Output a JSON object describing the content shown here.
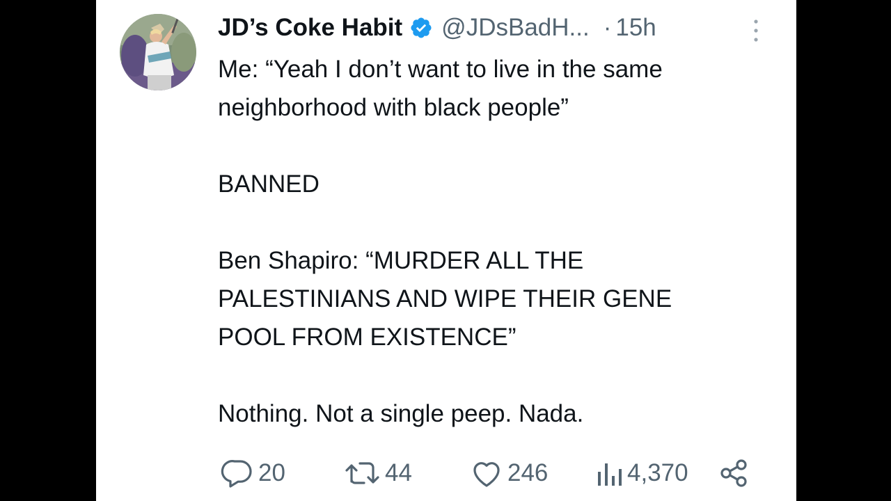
{
  "colors": {
    "text": "#0f1419",
    "muted": "#536471",
    "verified": "#1d9bf0",
    "background": "#ffffff",
    "letterbox": "#000000"
  },
  "tweet": {
    "author": {
      "display_name": "JD’s Coke Habit",
      "handle": "@JDsBadH...",
      "verified_icon": "verified-badge-icon",
      "avatar": "profile-avatar"
    },
    "separator": "·",
    "time": "15h",
    "more_icon": "more-options-icon",
    "body": {
      "line1": "Me: “Yeah I don’t want to live in the same",
      "line2": "neighborhood with black people”",
      "line3": "BANNED",
      "line4": "Ben Shapiro: “MURDER ALL THE",
      "line5": "PALESTINIANS AND WIPE THEIR GENE",
      "line6": "POOL FROM EXISTENCE”",
      "line7": "Nothing. Not a single peep. Nada."
    },
    "actions": {
      "replies": {
        "icon": "reply-icon",
        "count": "20"
      },
      "retweets": {
        "icon": "retweet-icon",
        "count": "44"
      },
      "likes": {
        "icon": "heart-icon",
        "count": "246"
      },
      "views": {
        "icon": "views-chart-icon",
        "count": "4,370"
      },
      "share": {
        "icon": "share-icon"
      }
    }
  }
}
